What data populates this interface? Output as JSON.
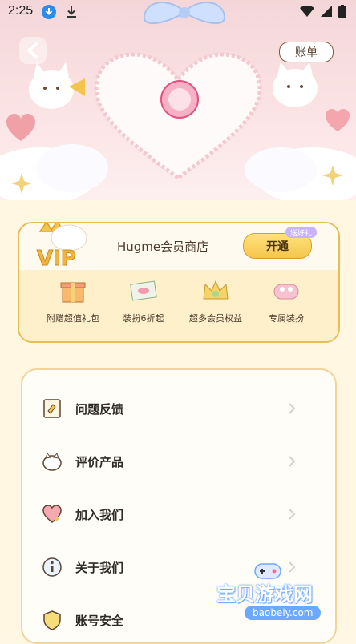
{
  "status": {
    "time": "2:25"
  },
  "header": {
    "bill_label": "账单"
  },
  "vip": {
    "title": "Hugme会员商店",
    "open_label": "开通",
    "badge": "送好礼",
    "perks": [
      {
        "label": "附赠超值礼包",
        "icon": "gift-box-icon"
      },
      {
        "label": "装扮6折起",
        "icon": "envelope-icon"
      },
      {
        "label": "超多会员权益",
        "icon": "crown-icon"
      },
      {
        "label": "专属装扮",
        "icon": "cushion-icon"
      }
    ]
  },
  "menu": {
    "items": [
      {
        "label": "问题反馈",
        "icon": "feedback-icon"
      },
      {
        "label": "评价产品",
        "icon": "rate-icon"
      },
      {
        "label": "加入我们",
        "icon": "heart-join-icon"
      },
      {
        "label": "关于我们",
        "icon": "info-icon"
      },
      {
        "label": "账号安全",
        "icon": "shield-icon"
      }
    ]
  },
  "watermark": {
    "text": "宝贝游戏网",
    "url": "baobeiy.com"
  },
  "colors": {
    "accent": "#f5c54a",
    "pink": "#f3b4bb",
    "border": "#e6be56"
  }
}
